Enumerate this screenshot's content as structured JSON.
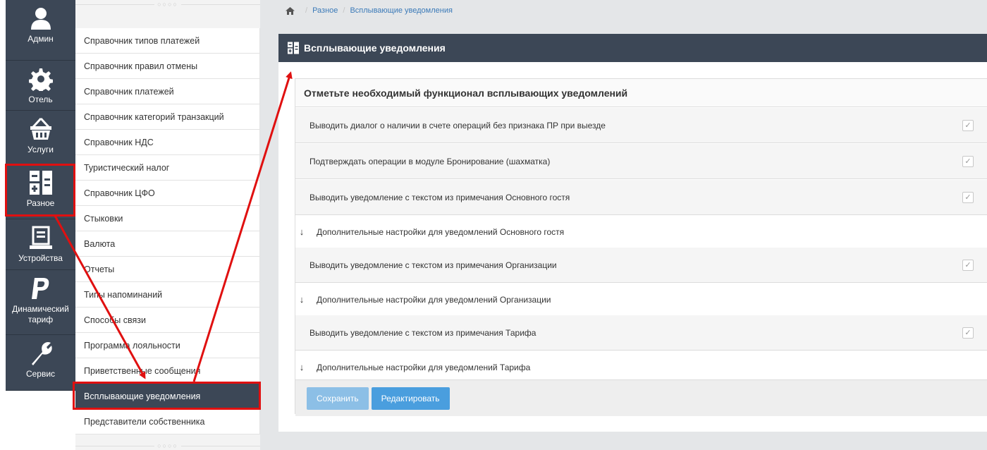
{
  "rail": [
    {
      "label": "Админ",
      "icon": "user-icon"
    },
    {
      "label": "Отель",
      "icon": "gear-icon"
    },
    {
      "label": "Услуги",
      "icon": "basket-icon"
    },
    {
      "label": "Разное",
      "icon": "calculator-icon"
    },
    {
      "label": "Устройства",
      "icon": "device-icon"
    },
    {
      "label": "Динамический тариф",
      "icon": "paypal-icon"
    },
    {
      "label": "Сервис",
      "icon": "wrench-icon"
    }
  ],
  "submenu": {
    "dots": "○○○○",
    "items": [
      "Справочник типов платежей",
      "Справочник правил отмены",
      "Справочник платежей",
      "Справочник категорий транзакций",
      "Справочник НДС",
      "Туристический налог",
      "Справочник ЦФО",
      "Стыковки",
      "Валюта",
      "Отчеты",
      "Типы напоминаний",
      "Способы связи",
      "Программа лояльности",
      "Приветственные сообщения",
      "Всплывающие уведомления",
      "Представители собственника"
    ],
    "active_index": 14
  },
  "breadcrumb": {
    "home_icon": "home-icon",
    "items": [
      "Разное",
      "Всплывающие уведомления"
    ]
  },
  "panel": {
    "title": "Всплывающие уведомления",
    "icon": "calculator-icon",
    "card_title": "Отметьте необходимый функционал всплывающих уведомлений",
    "rows": [
      {
        "type": "opt",
        "text": "Выводить диалог о наличии в счете операций без признака ПР при выезде",
        "checked": true
      },
      {
        "type": "opt",
        "text": "Подтверждать операции в модуле Бронирование (шахматка)",
        "checked": true
      },
      {
        "type": "opt",
        "text": "Выводить уведомление с текстом из примечания Основного гостя",
        "checked": true
      },
      {
        "type": "extra",
        "text": "Дополнительные настройки для уведомлений Основного гостя"
      },
      {
        "type": "opt",
        "text": "Выводить уведомление с текстом из примечания Организации",
        "checked": true
      },
      {
        "type": "extra",
        "text": "Дополнительные настройки для уведомлений Организации"
      },
      {
        "type": "opt",
        "text": "Выводить уведомление с текстом из примечания Тарифа",
        "checked": true
      },
      {
        "type": "extra",
        "text": "Дополнительные настройки для уведомлений Тарифа"
      }
    ],
    "buttons": {
      "save": "Сохранить",
      "edit": "Редактировать"
    }
  },
  "colors": {
    "dark": "#3c4756",
    "accent": "#4a9ede",
    "annotation": "#e01010"
  }
}
